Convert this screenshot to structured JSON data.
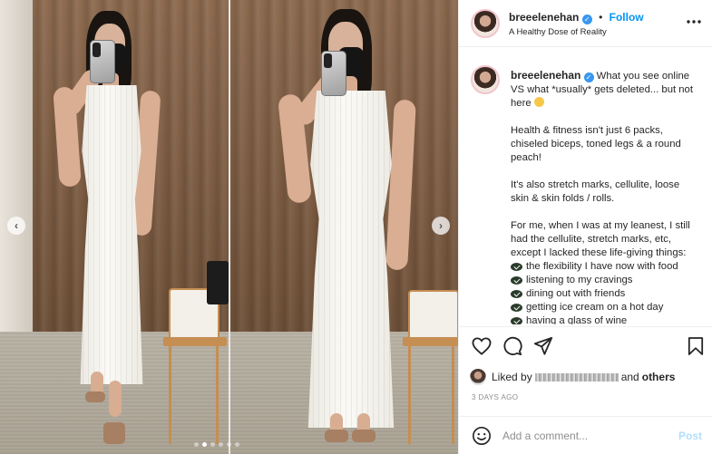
{
  "post": {
    "author": {
      "username": "breeelenehan",
      "verified": true,
      "subtitle": "A Healthy Dose of Reality",
      "follow_label": "Follow",
      "separator": "•"
    },
    "caption": {
      "intro": "What you see online VS what *usually* gets deleted... but not here",
      "paragraph1": "Health & fitness isn't just 6 packs, chiseled biceps, toned legs & a round peach!",
      "paragraph2": "It's also stretch marks, cellulite, loose skin & skin folds / rolls.",
      "paragraph3": "For me, when I was at my leanest, I still had the cellulite, stretch marks, etc, except I lacked these life-giving things:",
      "list": [
        "the flexibility I have now with food",
        "listening to my cravings",
        "dining out with friends",
        "getting ice cream on a hot day",
        "having a glass of wine"
      ]
    },
    "likes": {
      "prefix": "Liked by",
      "suffix_and": "and",
      "suffix_others": "others"
    },
    "timestamp": "3 DAYS AGO",
    "comment": {
      "placeholder": "Add a comment...",
      "post_label": "Post"
    },
    "carousel": {
      "total": 6,
      "active_index": 1
    }
  },
  "colors": {
    "accent": "#0095f6",
    "verified": "#3897f0",
    "post_disabled": "#b2dffc",
    "muted": "#8e8e8e"
  },
  "icons": [
    "heart-icon",
    "comment-icon",
    "share-icon",
    "bookmark-icon",
    "emoji-icon",
    "more-icon",
    "chevron-left-icon",
    "chevron-right-icon"
  ]
}
